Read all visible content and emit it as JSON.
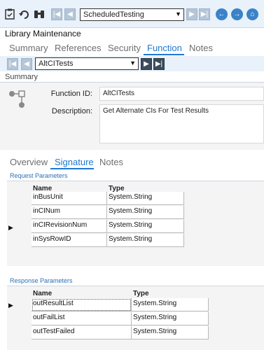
{
  "toolbar": {
    "record_select": "ScheduledTesting",
    "icons": [
      "clipboard-icon",
      "undo-icon",
      "binoculars-icon",
      "first-icon",
      "prev-icon",
      "next-icon",
      "last-icon",
      "back-icon",
      "forward-icon",
      "home-icon"
    ]
  },
  "app_title": "Library Maintenance",
  "tabs": [
    {
      "label": "Summary"
    },
    {
      "label": "References"
    },
    {
      "label": "Security"
    },
    {
      "label": "Function",
      "active": true
    },
    {
      "label": "Notes"
    }
  ],
  "function_nav": {
    "select_value": "AltCITests"
  },
  "summary": {
    "heading": "Summary",
    "function_id_label": "Function ID:",
    "function_id_value": "AltCITests",
    "description_label": "Description:",
    "description_value": "Get Alternate CIs For Test Results"
  },
  "subtabs": [
    {
      "label": "Overview"
    },
    {
      "label": "Signature",
      "active": true
    },
    {
      "label": "Notes"
    }
  ],
  "request": {
    "heading": "Request Parameters",
    "columns": [
      "Name",
      "Type"
    ],
    "rows": [
      {
        "name": "inBusUnit",
        "type": "System.String"
      },
      {
        "name": "inCINum",
        "type": "System.String"
      },
      {
        "name": "inCIRevisionNum",
        "type": "System.String"
      },
      {
        "name": "inSysRowID",
        "type": "System.String"
      }
    ]
  },
  "response": {
    "heading": "Response Parameters",
    "columns": [
      "Name",
      "Type"
    ],
    "rows": [
      {
        "name": "outResultList",
        "type": "System.String"
      },
      {
        "name": "outFailList",
        "type": "System.String"
      },
      {
        "name": "outTestFailed",
        "type": "System.String"
      }
    ]
  },
  "colors": {
    "accent": "#1f78d2",
    "toolbar_bg": "#e9f1fa",
    "nav_dark": "#3c4c5e"
  }
}
